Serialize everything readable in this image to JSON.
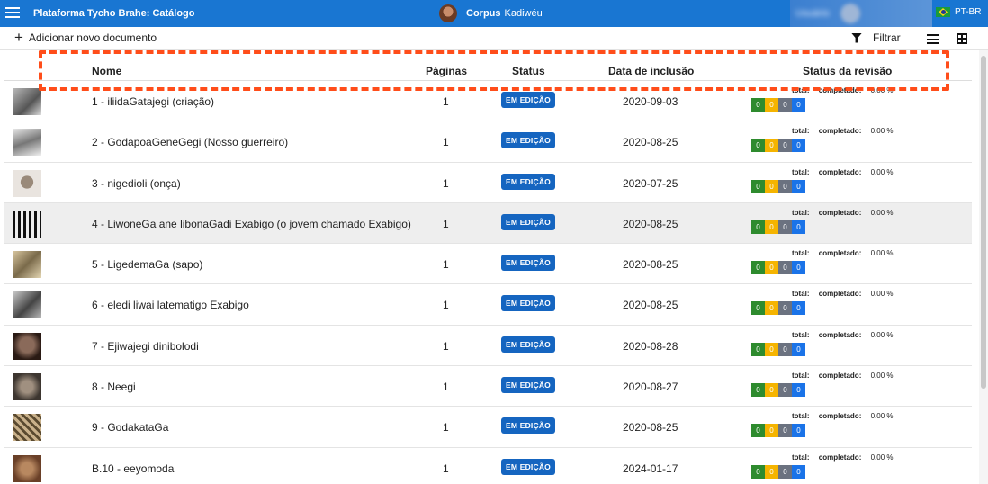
{
  "header": {
    "app_title": "Plataforma Tycho Brahe: Catálogo",
    "corpus_label": "Corpus",
    "corpus_name": "Kadiwéu",
    "language": "PT-BR",
    "icons": [
      "menu-icon",
      "corpus-avatar",
      "user-avatar",
      "brazil-flag-icon"
    ]
  },
  "toolbar": {
    "add_document_label": "Adicionar novo documento",
    "filter_label": "Filtrar",
    "icons": [
      "plus-icon",
      "filter-icon",
      "list-view-icon",
      "grid-view-icon"
    ]
  },
  "table": {
    "columns": [
      "Nome",
      "Páginas",
      "Status",
      "Data de inclusão",
      "Status da revisão"
    ],
    "review_total_label": "total:",
    "review_completed_label": "completado:",
    "status_colors": {
      "status_badge": "#1565c0",
      "box1": "#2e8b2e",
      "box2": "#f5b400",
      "box3": "#6b7280",
      "box4": "#1a73e8"
    },
    "rows": [
      {
        "name": "1 - iliidaGatajegi (criação)",
        "pages": "1",
        "status": "EM EDIÇÃO",
        "date": "2020-09-03",
        "completed": "0.00 %",
        "counts": [
          "0",
          "0",
          "0",
          "0"
        ]
      },
      {
        "name": "2 - GodapoaGeneGegi (Nosso guerreiro)",
        "pages": "1",
        "status": "EM EDIÇÃO",
        "date": "2020-08-25",
        "completed": "0.00 %",
        "counts": [
          "0",
          "0",
          "0",
          "0"
        ]
      },
      {
        "name": "3 - nigedioli (onça)",
        "pages": "1",
        "status": "EM EDIÇÃO",
        "date": "2020-07-25",
        "completed": "0.00 %",
        "counts": [
          "0",
          "0",
          "0",
          "0"
        ]
      },
      {
        "name": "4 - LiwoneGa ane libonaGadi Exabigo (o jovem chamado Exabigo)",
        "pages": "1",
        "status": "EM EDIÇÃO",
        "date": "2020-08-25",
        "completed": "0.00 %",
        "counts": [
          "0",
          "0",
          "0",
          "0"
        ]
      },
      {
        "name": "5 - LigedemaGa (sapo)",
        "pages": "1",
        "status": "EM EDIÇÃO",
        "date": "2020-08-25",
        "completed": "0.00 %",
        "counts": [
          "0",
          "0",
          "0",
          "0"
        ]
      },
      {
        "name": "6 - eledi liwai latematigo Exabigo",
        "pages": "1",
        "status": "EM EDIÇÃO",
        "date": "2020-08-25",
        "completed": "0.00 %",
        "counts": [
          "0",
          "0",
          "0",
          "0"
        ]
      },
      {
        "name": "7 - Ejiwajegi dinibolodi",
        "pages": "1",
        "status": "EM EDIÇÃO",
        "date": "2020-08-28",
        "completed": "0.00 %",
        "counts": [
          "0",
          "0",
          "0",
          "0"
        ]
      },
      {
        "name": "8 - Neegi",
        "pages": "1",
        "status": "EM EDIÇÃO",
        "date": "2020-08-27",
        "completed": "0.00 %",
        "counts": [
          "0",
          "0",
          "0",
          "0"
        ]
      },
      {
        "name": "9 - GodakataGa",
        "pages": "1",
        "status": "EM EDIÇÃO",
        "date": "2020-08-25",
        "completed": "0.00 %",
        "counts": [
          "0",
          "0",
          "0",
          "0"
        ]
      },
      {
        "name": "B.10 - eeyomoda",
        "pages": "1",
        "status": "EM EDIÇÃO",
        "date": "2024-01-17",
        "completed": "0.00 %",
        "counts": [
          "0",
          "0",
          "0",
          "0"
        ]
      }
    ]
  }
}
